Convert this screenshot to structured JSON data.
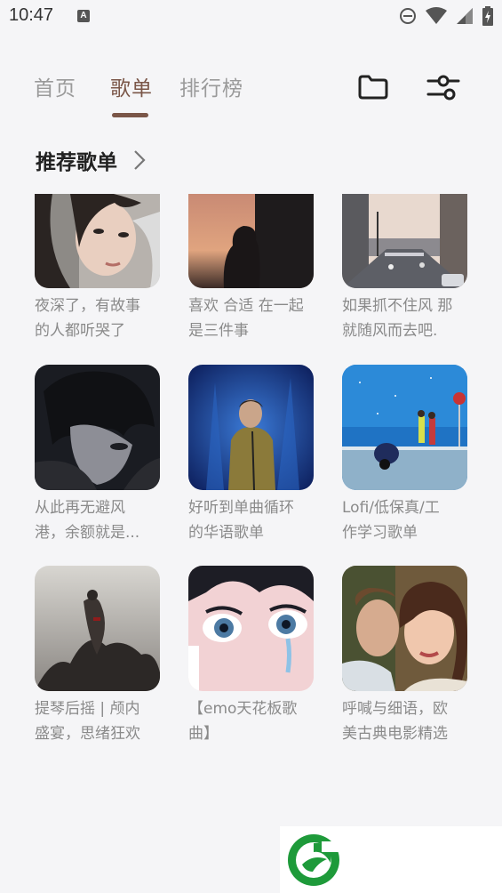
{
  "status_bar": {
    "time": "10:47",
    "a_badge": "A"
  },
  "nav": {
    "tabs": [
      {
        "label": "首页",
        "active": false
      },
      {
        "label": "歌单",
        "active": true
      },
      {
        "label": "排行榜",
        "active": false
      }
    ],
    "icons": [
      "folder-icon",
      "filter-sliders-icon"
    ],
    "accent_color": "#7a5648"
  },
  "section": {
    "title": "推荐歌单"
  },
  "playlists": [
    {
      "title": "夜深了，有故事的人都听哭了",
      "line1": "夜深了，有故事",
      "line2": "的人都听哭了",
      "cover": "portrait-girl"
    },
    {
      "title": "喜欢 合适 在一起是三件事",
      "line1": "喜欢 合适 在一起",
      "line2": "是三件事",
      "cover": "sunset-silhouette"
    },
    {
      "title": "如果抓不住风 那就随风而去吧.",
      "line1": "如果抓不住风 那",
      "line2": "就随风而去吧.",
      "cover": "city-street"
    },
    {
      "title": "从此再无避风港，余额就是...",
      "line1": "从此再无避风",
      "line2": "港，余额就是...",
      "cover": "anime-boy-dark"
    },
    {
      "title": "好听到单曲循环的华语歌单",
      "line1": "好听到单曲循环",
      "line2": "的华语歌单",
      "cover": "singer-blue-stage"
    },
    {
      "title": "Lofi/低保真/工作学习歌单",
      "line1": "Lofi/低保真/工",
      "line2": "作学习歌单",
      "cover": "anime-couple-seaside"
    },
    {
      "title": "提琴后摇 | 颅内盛宴，思绪狂欢",
      "line1": "提琴后摇 | 颅内",
      "line2": "盛宴，思绪狂欢",
      "cover": "dark-gown-art"
    },
    {
      "title": "【emo天花板歌曲】",
      "line1": "【emo天花板歌",
      "line2": "曲】",
      "cover": "crying-eye-illustration"
    },
    {
      "title": "呼喊与细语，欧美古典电影精选",
      "line1": "呼喊与细语，欧",
      "line2": "美古典电影精选",
      "cover": "classic-film-couple"
    }
  ]
}
